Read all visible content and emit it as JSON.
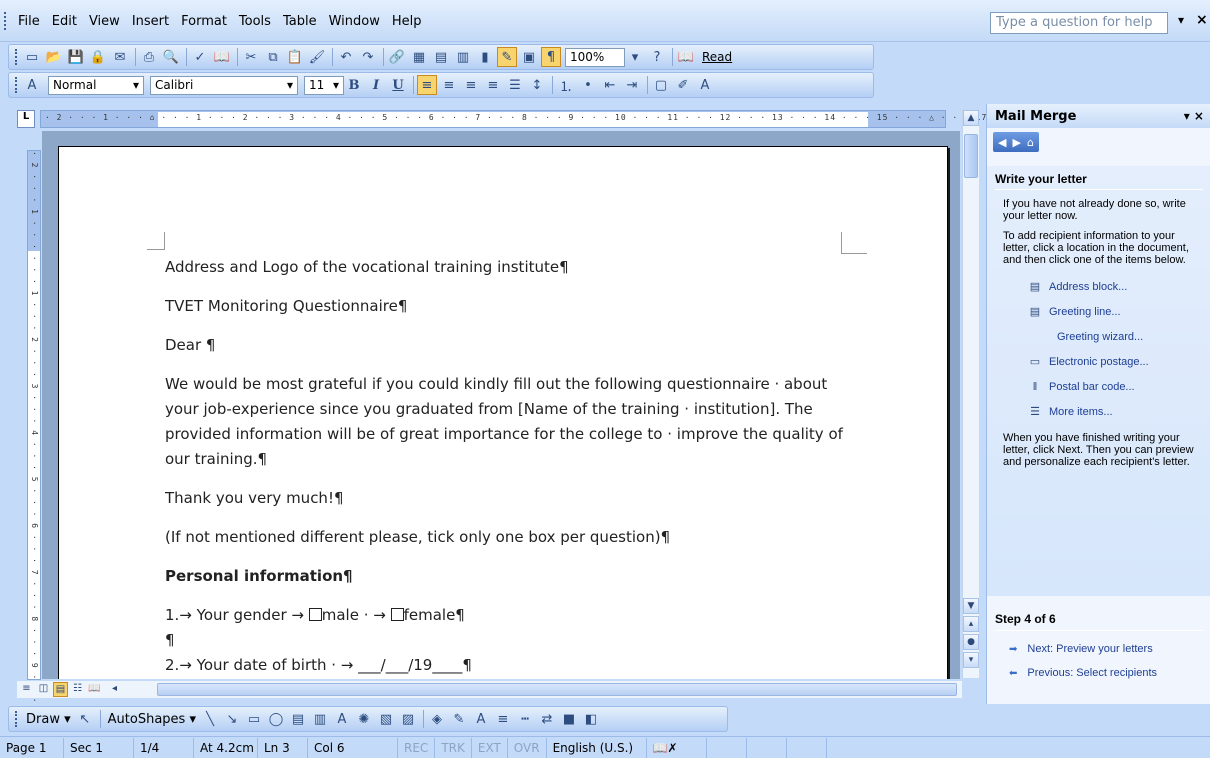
{
  "menu": {
    "items": [
      "File",
      "Edit",
      "View",
      "Insert",
      "Format",
      "Tools",
      "Table",
      "Window",
      "Help"
    ],
    "help_placeholder": "Type a question for help"
  },
  "toolbar": {
    "zoom": "100%",
    "read_label": "Read",
    "style": "Normal",
    "font": "Calibri",
    "size": "11",
    "bold": "B",
    "italic": "I",
    "underline": "U"
  },
  "ruler": {
    "h_ticks": "· 2 · · · 1 · · · ⌂ · · · 1 · · · 2 · · · 3 · · · 4 · · · 5 · · · 6 · · · 7 · · · 8 · · · 9 · · · 10 · · · 11 · · · 12 · · · 13 · · · 14 · · · 15 · · · △ · · · 17 · · · 18 ·",
    "v_ticks": "· 2 · · · 1 · · · · · · 1 · · · 2 · · · 3 · · · 4 · · · 5 · · · 6 · · · 7 · · · 8 · · · 9 · · · 10"
  },
  "document": {
    "line1": "Address and Logo of the vocational training institute¶",
    "line2": "TVET Monitoring Questionnaire¶",
    "line3": "Dear ¶",
    "line4": "We would be most grateful if you could kindly fill out the following questionnaire · about your job-experience since you graduated from [Name of the training · institution]. The provided information will be of great importance for the college to · improve the quality of our training.¶",
    "line5": "Thank you very much!¶",
    "line6": "(If not mentioned different please, tick only one box per question)¶",
    "line7": "Personal information¶",
    "q1_prefix": "1.→ Your gender →",
    "q1_male": "male · →",
    "q1_female": "female¶",
    "blank1": "¶",
    "q2": "2.→ Your date of birth · →  ___/___/19____¶",
    "blank2": "¶"
  },
  "drawbar": {
    "draw_label": "Draw",
    "autoshapes_label": "AutoShapes"
  },
  "status": {
    "page": "Page 1",
    "sec": "Sec 1",
    "pages": "1/4",
    "at": "At 4.2cm",
    "ln": "Ln 3",
    "col": "Col 6",
    "rec": "REC",
    "trk": "TRK",
    "ext": "EXT",
    "ovr": "OVR",
    "lang": "English (U.S.)"
  },
  "taskpane": {
    "title": "Mail Merge",
    "section_title": "Write your letter",
    "p1": "If you have not already done so, write your letter now.",
    "p2": "To add recipient information to your letter, click a location in the document, and then click one of the items below.",
    "links": [
      "Address block...",
      "Greeting line...",
      "Greeting wizard...",
      "Electronic postage...",
      "Postal bar code...",
      "More items..."
    ],
    "p3": "When you have finished writing your letter, click Next. Then you can preview and personalize each recipient's letter.",
    "step": "Step 4 of 6",
    "next": "Next: Preview your letters",
    "prev": "Previous: Select recipients"
  }
}
